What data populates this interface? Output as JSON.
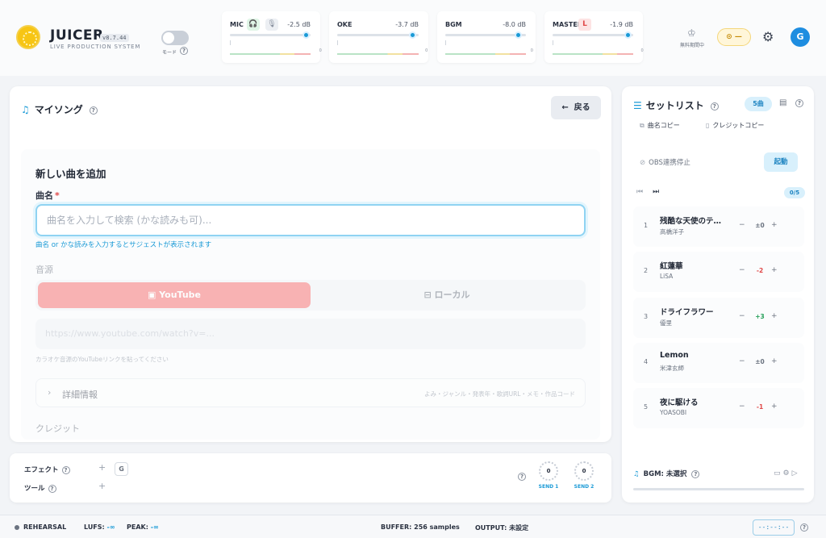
{
  "header": {
    "brand": "JUICER",
    "version": "v8.7.44",
    "subtitle": "LIVE PRODUCTION SYSTEM",
    "mode_label": "モード",
    "mode_on": false,
    "help_glyph": "?",
    "meters": [
      {
        "name": "MIC",
        "db": "-2.5 dB",
        "level": 0.94,
        "extras": [
          "headphone-icon",
          "mic-icon"
        ]
      },
      {
        "name": "OKE",
        "db": "-3.7 dB",
        "level": 0.92
      },
      {
        "name": "BGM",
        "db": "-8.0 dB",
        "level": 0.9
      },
      {
        "name": "MASTER",
        "db": "-1.9 dB",
        "level": 0.93,
        "badge": "L"
      }
    ],
    "meter_zero_label": "0",
    "trial_label": "無料期間中",
    "coin_value": "—",
    "avatar_initial": "G"
  },
  "my_songs": {
    "title": "マイソング",
    "back_label": "戻る",
    "form": {
      "title": "新しい曲を追加",
      "name_label": "曲名",
      "required_mark": "*",
      "name_placeholder": "曲名を入力して検索 (かな読みも可)...",
      "name_hint": "曲名 or かな読みを入力するとサジェストが表示されます",
      "source_label": "音源",
      "source_youtube": "YouTube",
      "source_local": "ローカル",
      "url_placeholder": "https://www.youtube.com/watch?v=...",
      "url_hint": "カラオケ音源のYouTubeリンクを貼ってください",
      "details_label": "詳細情報",
      "details_summary": "よみ・ジャンル・発表年・歌詞URL・メモ・作品コード",
      "credit_label": "クレジット"
    }
  },
  "fx": {
    "effect_label": "エフェクト",
    "tool_label": "ツール",
    "add_glyph": "+",
    "effect_chip": "G",
    "sends": [
      {
        "label": "SEND 1",
        "value": "0"
      },
      {
        "label": "SEND 2",
        "value": "0"
      }
    ]
  },
  "setlist": {
    "title": "セットリスト",
    "count": "5曲",
    "copy_song": "曲名コピー",
    "copy_credit": "クレジットコピー",
    "obs_status": "OBS連携停止",
    "launch_label": "起動",
    "progress": "0/5",
    "songs": [
      {
        "no": "1",
        "title": "残酷な天使のテ…",
        "artist": "高橋洋子",
        "key": "±0",
        "key_color": "#6b7380"
      },
      {
        "no": "2",
        "title": "紅蓮華",
        "artist": "LiSA",
        "key": "-2",
        "key_color": "#e04848"
      },
      {
        "no": "3",
        "title": "ドライフラワー",
        "artist": "優里",
        "key": "+3",
        "key_color": "#26a05a"
      },
      {
        "no": "4",
        "title": "Lemon",
        "artist": "米津玄師",
        "key": "±0",
        "key_color": "#6b7380"
      },
      {
        "no": "5",
        "title": "夜に駆ける",
        "artist": "YOASOBI",
        "key": "-1",
        "key_color": "#e04848"
      }
    ],
    "minus_glyph": "−",
    "plus_glyph": "+",
    "bgm_label": "BGM: 未選択"
  },
  "status": {
    "mode": "REHEARSAL",
    "lufs_label": "LUFS:",
    "lufs_value": "-∞",
    "peak_label": "PEAK:",
    "peak_value": "-∞",
    "buffer": "BUFFER: 256 samples",
    "output": "OUTPUT: 未設定",
    "time": "--:--:--"
  }
}
